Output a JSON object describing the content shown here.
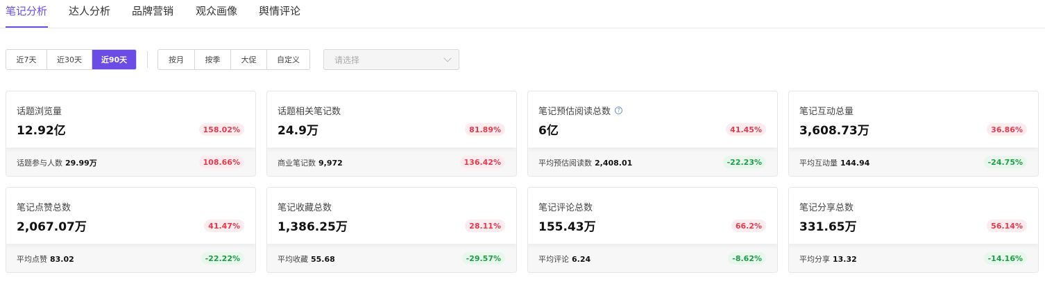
{
  "tabs": [
    "笔记分析",
    "达人分析",
    "品牌营销",
    "观众画像",
    "舆情评论"
  ],
  "filters": {
    "range_buttons": [
      "近7天",
      "近30天",
      "近90天"
    ],
    "period_buttons": [
      "按月",
      "按季",
      "大促",
      "自定义"
    ],
    "select_placeholder": "请选择"
  },
  "colors": {
    "accent": "#6b4de6",
    "positive": "#e53a4e",
    "negative": "#1e9e48"
  },
  "cards": [
    {
      "title": "话题浏览量",
      "value": "12.92亿",
      "change": "158.02%",
      "sub_label": "话题参与人数",
      "sub_value": "29.99万",
      "sub_change": "108.66%"
    },
    {
      "title": "话题相关笔记数",
      "value": "24.9万",
      "change": "81.89%",
      "sub_label": "商业笔记数",
      "sub_value": "9,972",
      "sub_change": "136.42%"
    },
    {
      "title": "笔记预估阅读总数",
      "value": "6亿",
      "change": "41.45%",
      "sub_label": "平均预估阅读数",
      "sub_value": "2,408.01",
      "sub_change": "-22.23%"
    },
    {
      "title": "笔记互动总量",
      "value": "3,608.73万",
      "change": "36.86%",
      "sub_label": "平均互动量",
      "sub_value": "144.94",
      "sub_change": "-24.75%"
    },
    {
      "title": "笔记点赞总数",
      "value": "2,067.07万",
      "change": "41.47%",
      "sub_label": "平均点赞",
      "sub_value": "83.02",
      "sub_change": "-22.22%"
    },
    {
      "title": "笔记收藏总数",
      "value": "1,386.25万",
      "change": "28.11%",
      "sub_label": "平均收藏",
      "sub_value": "55.68",
      "sub_change": "-29.57%"
    },
    {
      "title": "笔记评论总数",
      "value": "155.43万",
      "change": "66.2%",
      "sub_label": "平均评论",
      "sub_value": "6.24",
      "sub_change": "-8.62%"
    },
    {
      "title": "笔记分享总数",
      "value": "331.65万",
      "change": "56.14%",
      "sub_label": "平均分享",
      "sub_value": "13.32",
      "sub_change": "-14.16%"
    }
  ]
}
